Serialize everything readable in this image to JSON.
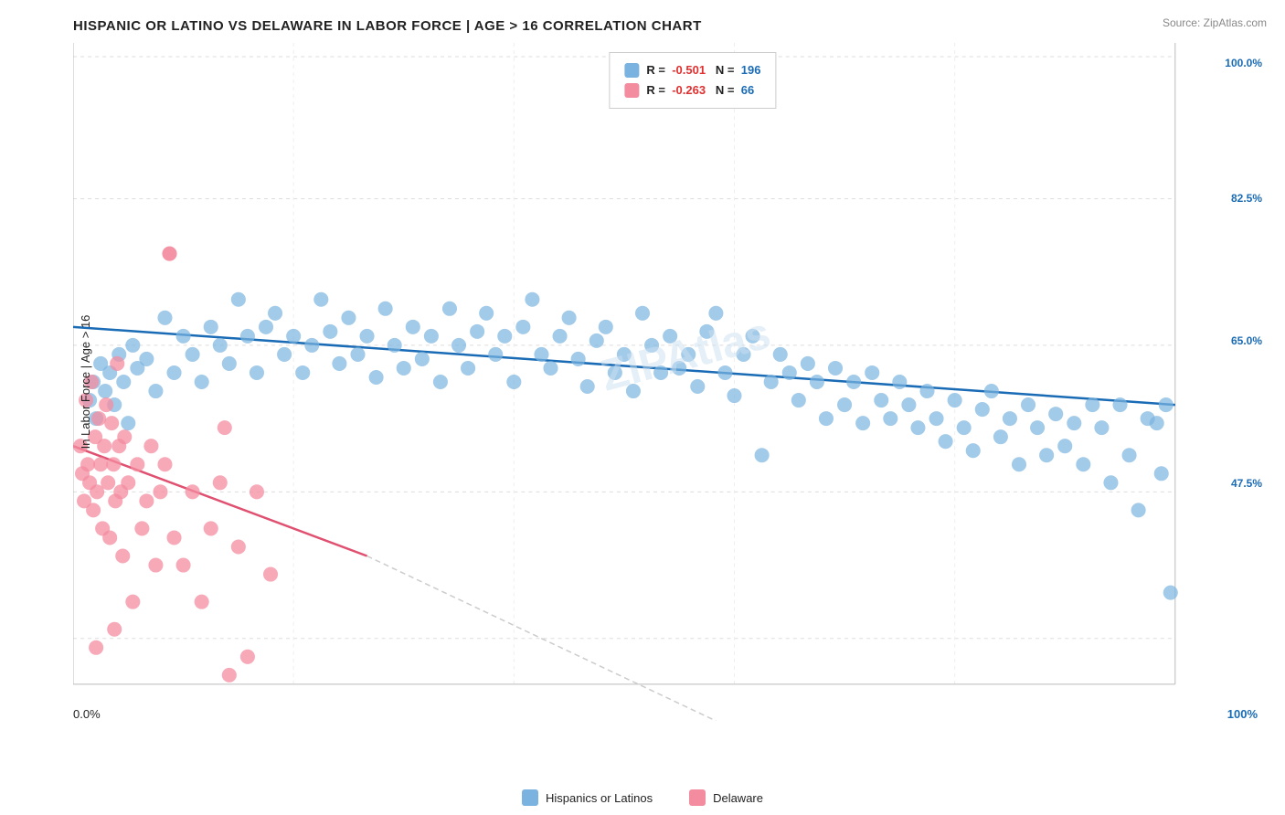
{
  "title": "HISPANIC OR LATINO VS DELAWARE IN LABOR FORCE | AGE > 16 CORRELATION CHART",
  "source": "Source: ZipAtlas.com",
  "legend": {
    "blue": {
      "r_label": "R =",
      "r_value": "-0.501",
      "n_label": "N =",
      "n_value": "196",
      "color": "#7ab3e0"
    },
    "pink": {
      "r_label": "R =",
      "r_value": "-0.263",
      "n_label": "N =",
      "n_value": "66",
      "color": "#f48ca0"
    }
  },
  "y_axis": {
    "label": "In Labor Force | Age > 16",
    "ticks": [
      {
        "label": "100.0%",
        "pct": 0
      },
      {
        "label": "82.5%",
        "pct": 21
      },
      {
        "label": "65.0%",
        "pct": 43
      },
      {
        "label": "47.5%",
        "pct": 64
      }
    ]
  },
  "x_axis": {
    "label_left": "0.0%",
    "label_right": "100%"
  },
  "bottom_legend": {
    "item1": {
      "label": "Hispanics or Latinos",
      "color": "#7ab3e0"
    },
    "item2": {
      "label": "Delaware",
      "color": "#f48ca0"
    }
  },
  "watermark": "ZIPAtlas"
}
